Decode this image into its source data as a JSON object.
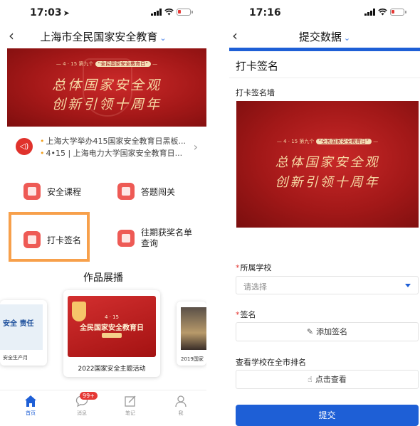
{
  "left": {
    "status_time": "17:03",
    "nav_title": "上海市全民国家安全教育",
    "banner": {
      "subtitle_pre": "4 · 15 第九个 ",
      "subtitle_hl": "“全民国家安全教育日”",
      "line1": "总体国家安全观",
      "line2": "创新引领十周年"
    },
    "news": [
      "上海大学举办415国家安全教育日黑板...",
      "4•15 | 上海电力大学国家安全教育日..."
    ],
    "menu": {
      "course": "安全课程",
      "quiz": "答题闯关",
      "checkin": "打卡签名",
      "winners_line1": "往期获奖名单",
      "winners_line2": "查询"
    },
    "gallery_title": "作品展播",
    "gallery": {
      "left_art": "安全 责任",
      "left_caption": "安全生产月",
      "center_small": "4 · 15",
      "center_big": "全民国家安全教育日",
      "center_caption": "2022国家安全主题活动",
      "right_caption": "2019国家"
    },
    "tabs": {
      "home": "首页",
      "messages": "消息",
      "notes": "笔记",
      "me": "我"
    },
    "badge": "99+"
  },
  "right": {
    "status_time": "17:16",
    "nav_title": "提交数据",
    "form_title": "打卡签名",
    "wall_label": "打卡签名墙",
    "wall_banner": {
      "subtitle_pre": "4 · 15 第九个 ",
      "subtitle_hl": "“全民国家安全教育日”",
      "line1": "总体国家安全观",
      "line2": "创新引领十周年"
    },
    "school_label": "所属学校",
    "school_placeholder": "请选择",
    "sign_label": "签名",
    "add_sign": "添加签名",
    "rank_label": "查看学校在全市排名",
    "view_rank": "点击查看",
    "submit": "提交"
  },
  "colors": {
    "accent": "#1e5fd6",
    "banner_red": "#a41818",
    "highlight_orange": "#f7a04b",
    "icon_red": "#ee5a55"
  }
}
